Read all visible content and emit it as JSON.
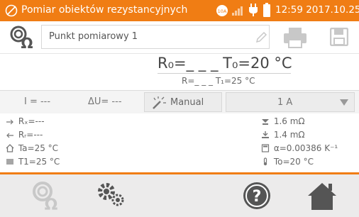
{
  "status": {
    "title": "Pomiar obiektów rezystancyjnych",
    "battery_badge": "10A",
    "time": "12:59 2017.10.25"
  },
  "point": {
    "name": "Punkt pomiarowy 1"
  },
  "result": {
    "main": "R₀=_ _ _ T₀=20 °C",
    "sub": "R=_ _ _ T₁=25 °C"
  },
  "settings": {
    "current": "I = ---",
    "voltage_drop": "ΔU= ---",
    "mode": "Manual",
    "test_current": "1 A"
  },
  "details": {
    "rf": "Rₓ=---",
    "rr": "Rᵣ=---",
    "ta": "Ta=25 °C",
    "t1": "T1=25 °C",
    "val1": "1.6 mΩ",
    "val2": "1.4 mΩ",
    "alpha": "α=0.00386 K⁻¹",
    "t0": "To=20 °C"
  },
  "colors": {
    "accent": "#f07d14",
    "nav_icon": "#555555",
    "nav_disabled": "#c8c8c8"
  }
}
